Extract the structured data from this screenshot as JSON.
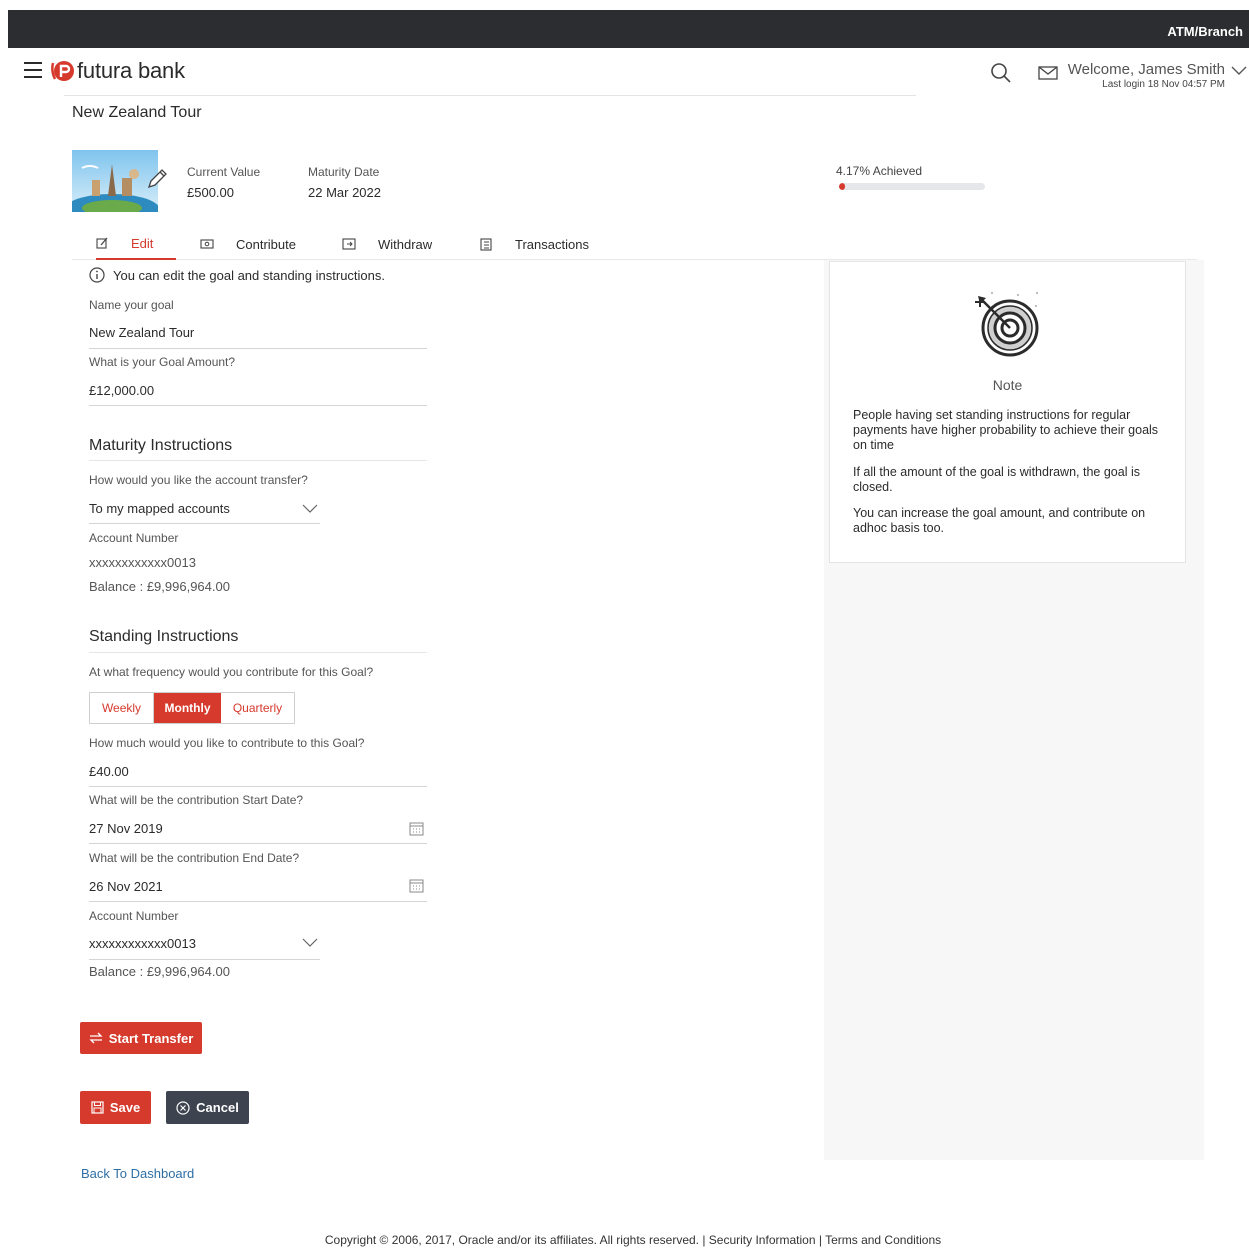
{
  "topbar": {
    "atm_branch": "ATM/Branch"
  },
  "header": {
    "brand": "futura bank",
    "welcome": "Welcome, James Smith",
    "last_login": "Last login 18 Nov 04:57 PM"
  },
  "page": {
    "title": "New Zealand Tour"
  },
  "summary": {
    "current_value_label": "Current Value",
    "current_value": "£500.00",
    "maturity_date_label": "Maturity Date",
    "maturity_date": "22 Mar 2022",
    "achieved_label": "4.17% Achieved",
    "achieved_fraction": 0.0417
  },
  "tabs": [
    {
      "label": "Edit",
      "icon": "edit-icon",
      "active": true
    },
    {
      "label": "Contribute",
      "icon": "contribute-icon",
      "active": false
    },
    {
      "label": "Withdraw",
      "icon": "withdraw-icon",
      "active": false
    },
    {
      "label": "Transactions",
      "icon": "transactions-icon",
      "active": false
    }
  ],
  "form": {
    "info": "You can edit the goal and standing instructions.",
    "goal_name_label": "Name your goal",
    "goal_name": "New Zealand Tour",
    "goal_amount_label": "What is your Goal Amount?",
    "goal_amount": "£12,000.00",
    "maturity": {
      "title": "Maturity Instructions",
      "transfer_label": "How would you like the account transfer?",
      "transfer_value": "To my mapped accounts",
      "account_label": "Account Number",
      "account_value": "xxxxxxxxxxxx0013",
      "balance": "Balance : £9,996,964.00"
    },
    "standing": {
      "title": "Standing Instructions",
      "frequency_label": "At what frequency would you contribute for this Goal?",
      "frequency_options": [
        "Weekly",
        "Monthly",
        "Quarterly"
      ],
      "frequency_selected": "Monthly",
      "amount_label": "How much would you like to contribute to this Goal?",
      "amount": "£40.00",
      "start_label": "What will be the contribution Start Date?",
      "start_date": "27 Nov 2019",
      "end_label": "What will be the contribution End Date?",
      "end_date": "26 Nov 2021",
      "account_label": "Account Number",
      "account_value": "xxxxxxxxxxxx0013",
      "balance": "Balance : £9,996,964.00"
    },
    "start_transfer": "Start Transfer",
    "save": "Save",
    "cancel": "Cancel"
  },
  "note": {
    "title": "Note",
    "lines": [
      "People having set standing instructions for regular payments have higher probability to achieve their goals on time",
      "If all the amount of the goal is withdrawn, the goal is closed.",
      "You can increase the goal amount, and contribute on adhoc basis too."
    ]
  },
  "back_link": "Back To Dashboard",
  "footer": "Copyright © 2006, 2017, Oracle and/or its affiliates. All rights reserved. | Security Information | Terms and Conditions",
  "colors": {
    "accent": "#d63a2d",
    "dark": "#2b2d31",
    "link": "#2d6ea5"
  }
}
